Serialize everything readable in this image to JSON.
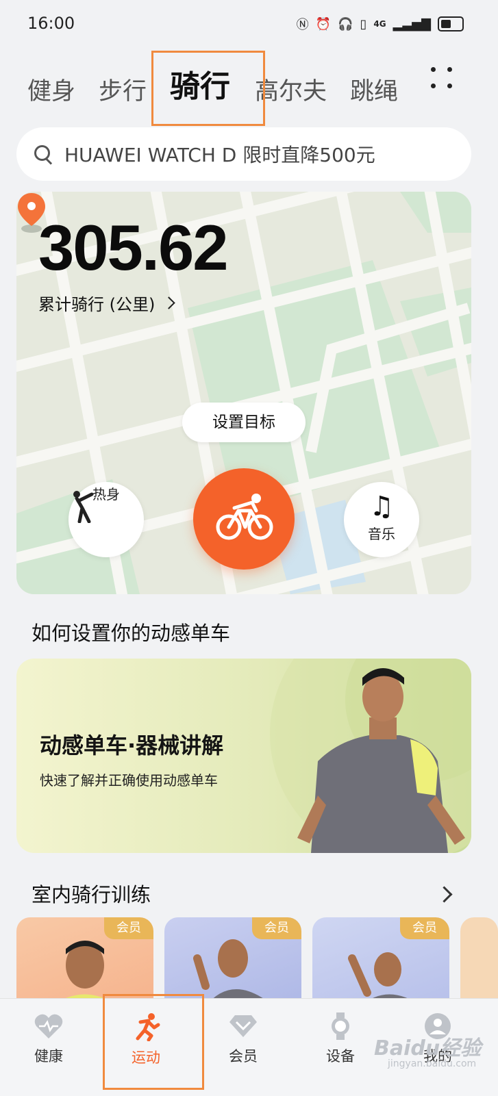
{
  "status_bar": {
    "time": "16:00",
    "icons": [
      "fan-icon",
      "nfc-icon",
      "alarm-icon",
      "headphones-icon",
      "vibrate-icon",
      "signal-4g-icon",
      "battery-icon"
    ],
    "network": "4G"
  },
  "tabs": {
    "items": [
      {
        "label": "健身"
      },
      {
        "label": "步行"
      },
      {
        "label": "骑行",
        "active": true
      },
      {
        "label": "高尔夫"
      },
      {
        "label": "跳绳"
      }
    ]
  },
  "search": {
    "placeholder": "HUAWEI WATCH D 限时直降500元"
  },
  "ride": {
    "distance": "305.62",
    "distance_label": "累计骑行 (公里)",
    "goal_button": "设置目标",
    "warmup_label": "热身",
    "music_label": "音乐"
  },
  "section_setup": {
    "title": "如何设置你的动感单车"
  },
  "banner": {
    "title": "动感单车·器械讲解",
    "subtitle": "快速了解并正确使用动感单车"
  },
  "section_indoor": {
    "title": "室内骑行训练"
  },
  "courses": [
    {
      "badge": "会员"
    },
    {
      "badge": "会员"
    },
    {
      "badge": "会员"
    }
  ],
  "bottom_nav": {
    "items": [
      {
        "label": "健康",
        "icon": "heart-icon"
      },
      {
        "label": "运动",
        "icon": "running-icon",
        "active": true
      },
      {
        "label": "会员",
        "icon": "diamond-icon"
      },
      {
        "label": "设备",
        "icon": "watch-icon"
      },
      {
        "label": "我的",
        "icon": "profile-icon"
      }
    ]
  },
  "watermark": {
    "text": "Baidu经验",
    "sub": "jingyan.baidu.com"
  },
  "colors": {
    "accent": "#f4622a",
    "highlight_box": "#f08a3e",
    "vip_badge": "#e9b658",
    "map_green": "#cfe6cf",
    "map_base": "#e8ebe0"
  }
}
